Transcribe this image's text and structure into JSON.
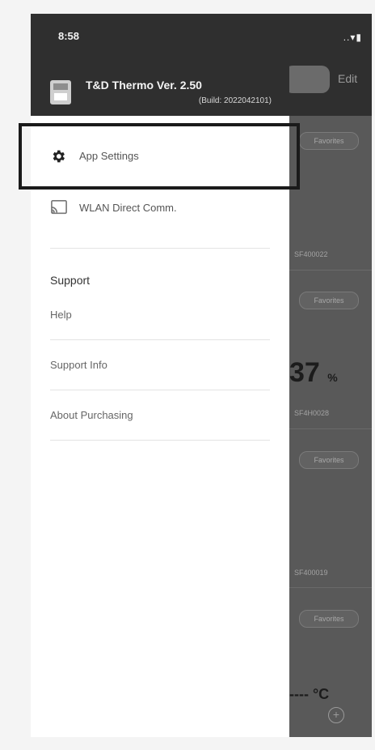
{
  "status_bar": {
    "time": "8:58",
    "indicators": "..▾▮"
  },
  "drawer": {
    "app_title": "T&D Thermo Ver. 2.50",
    "build": "(Build: 2022042101)",
    "items": [
      {
        "label": "App Settings",
        "icon": "gear-icon"
      },
      {
        "label": "WLAN Direct Comm.",
        "icon": "cast-icon"
      }
    ],
    "support": {
      "title": "Support",
      "links": [
        "Help",
        "Support Info",
        "About Purchasing"
      ]
    }
  },
  "background": {
    "edit_label": "Edit",
    "favorites_label": "Favorites",
    "serials": [
      "SF400022",
      "SF4H0028",
      "SF400019"
    ],
    "reading_value": "37",
    "reading_unit": "%",
    "temp_placeholder": "---- °C",
    "add_label": "+"
  }
}
